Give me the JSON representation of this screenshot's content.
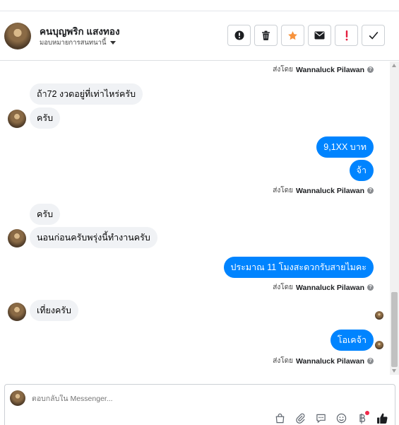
{
  "header": {
    "name": "คนบุญพริก แสงทอง",
    "assign_label": "มอบหมายการสนทนานี้",
    "actions": [
      {
        "name": "spam-button",
        "icon": "exclamation-circle-icon",
        "color": "#1c1e21"
      },
      {
        "name": "delete-button",
        "icon": "trash-icon",
        "color": "#1c1e21"
      },
      {
        "name": "follow-up-button",
        "icon": "star-icon",
        "color": "#f7923b"
      },
      {
        "name": "mark-unread-button",
        "icon": "envelope-icon",
        "color": "#1c1e21"
      },
      {
        "name": "important-button",
        "icon": "exclamation-icon",
        "color": "#e41e3f"
      },
      {
        "name": "mark-done-button",
        "icon": "check-icon",
        "color": "#1c1e21"
      }
    ]
  },
  "thread": {
    "sent_by_prefix": "ส่งโดย",
    "sender": "Wannaluck Pilawan",
    "messages": [
      {
        "dir": "in",
        "text": "ถ้า72   งวดอยู่ที่เท่าไหร่ครับ"
      },
      {
        "dir": "in",
        "text": "ครับ"
      },
      {
        "dir": "out",
        "text": "9,1XX  บาท"
      },
      {
        "dir": "out",
        "text": "จ้า"
      },
      {
        "dir": "in",
        "text": "ครับ"
      },
      {
        "dir": "in",
        "text": "นอนก่อนครับพรุ่งนี้ทำงานครับ"
      },
      {
        "dir": "out",
        "text": "ประมาณ 11 โมงสะดวกรับสายไมคะ"
      },
      {
        "dir": "in",
        "text": "เที่ยงครับ"
      },
      {
        "dir": "out",
        "text": "โอเคจ้า"
      }
    ]
  },
  "composer": {
    "placeholder": "ตอบกลับใน Messenger...",
    "tools": [
      "bag-icon",
      "paperclip-icon",
      "saved-reply-icon",
      "emoji-icon",
      "payment-icon",
      "thumbs-up-icon"
    ],
    "like_color": "#1c1e21"
  },
  "colors": {
    "accent": "#0084ff",
    "incoming_bubble": "#f0f2f5"
  }
}
